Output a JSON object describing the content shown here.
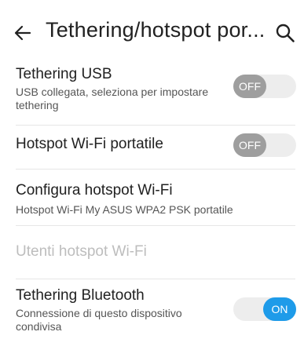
{
  "header": {
    "title": "Tethering/hotspot por...",
    "back_icon": "arrow-left-icon",
    "search_icon": "search-icon"
  },
  "settings": [
    {
      "title": "Tethering USB",
      "subtitle": "USB collegata, seleziona per impostare tethering",
      "toggle": "OFF"
    },
    {
      "title": "Hotspot Wi-Fi portatile",
      "toggle": "OFF"
    },
    {
      "title": "Configura hotspot Wi-Fi",
      "subtitle": "Hotspot Wi-Fi My ASUS WPA2 PSK portatile"
    },
    {
      "title": "Utenti hotspot Wi-Fi",
      "enabled": false
    },
    {
      "title": "Tethering Bluetooth",
      "subtitle": "Connessione di questo dispositivo condivisa",
      "toggle": "ON"
    }
  ],
  "colors": {
    "accent": "#1e9be9",
    "toggle_off": "#9e9e9e",
    "track": "#ededed",
    "disabled_text": "#bdbdbd"
  }
}
